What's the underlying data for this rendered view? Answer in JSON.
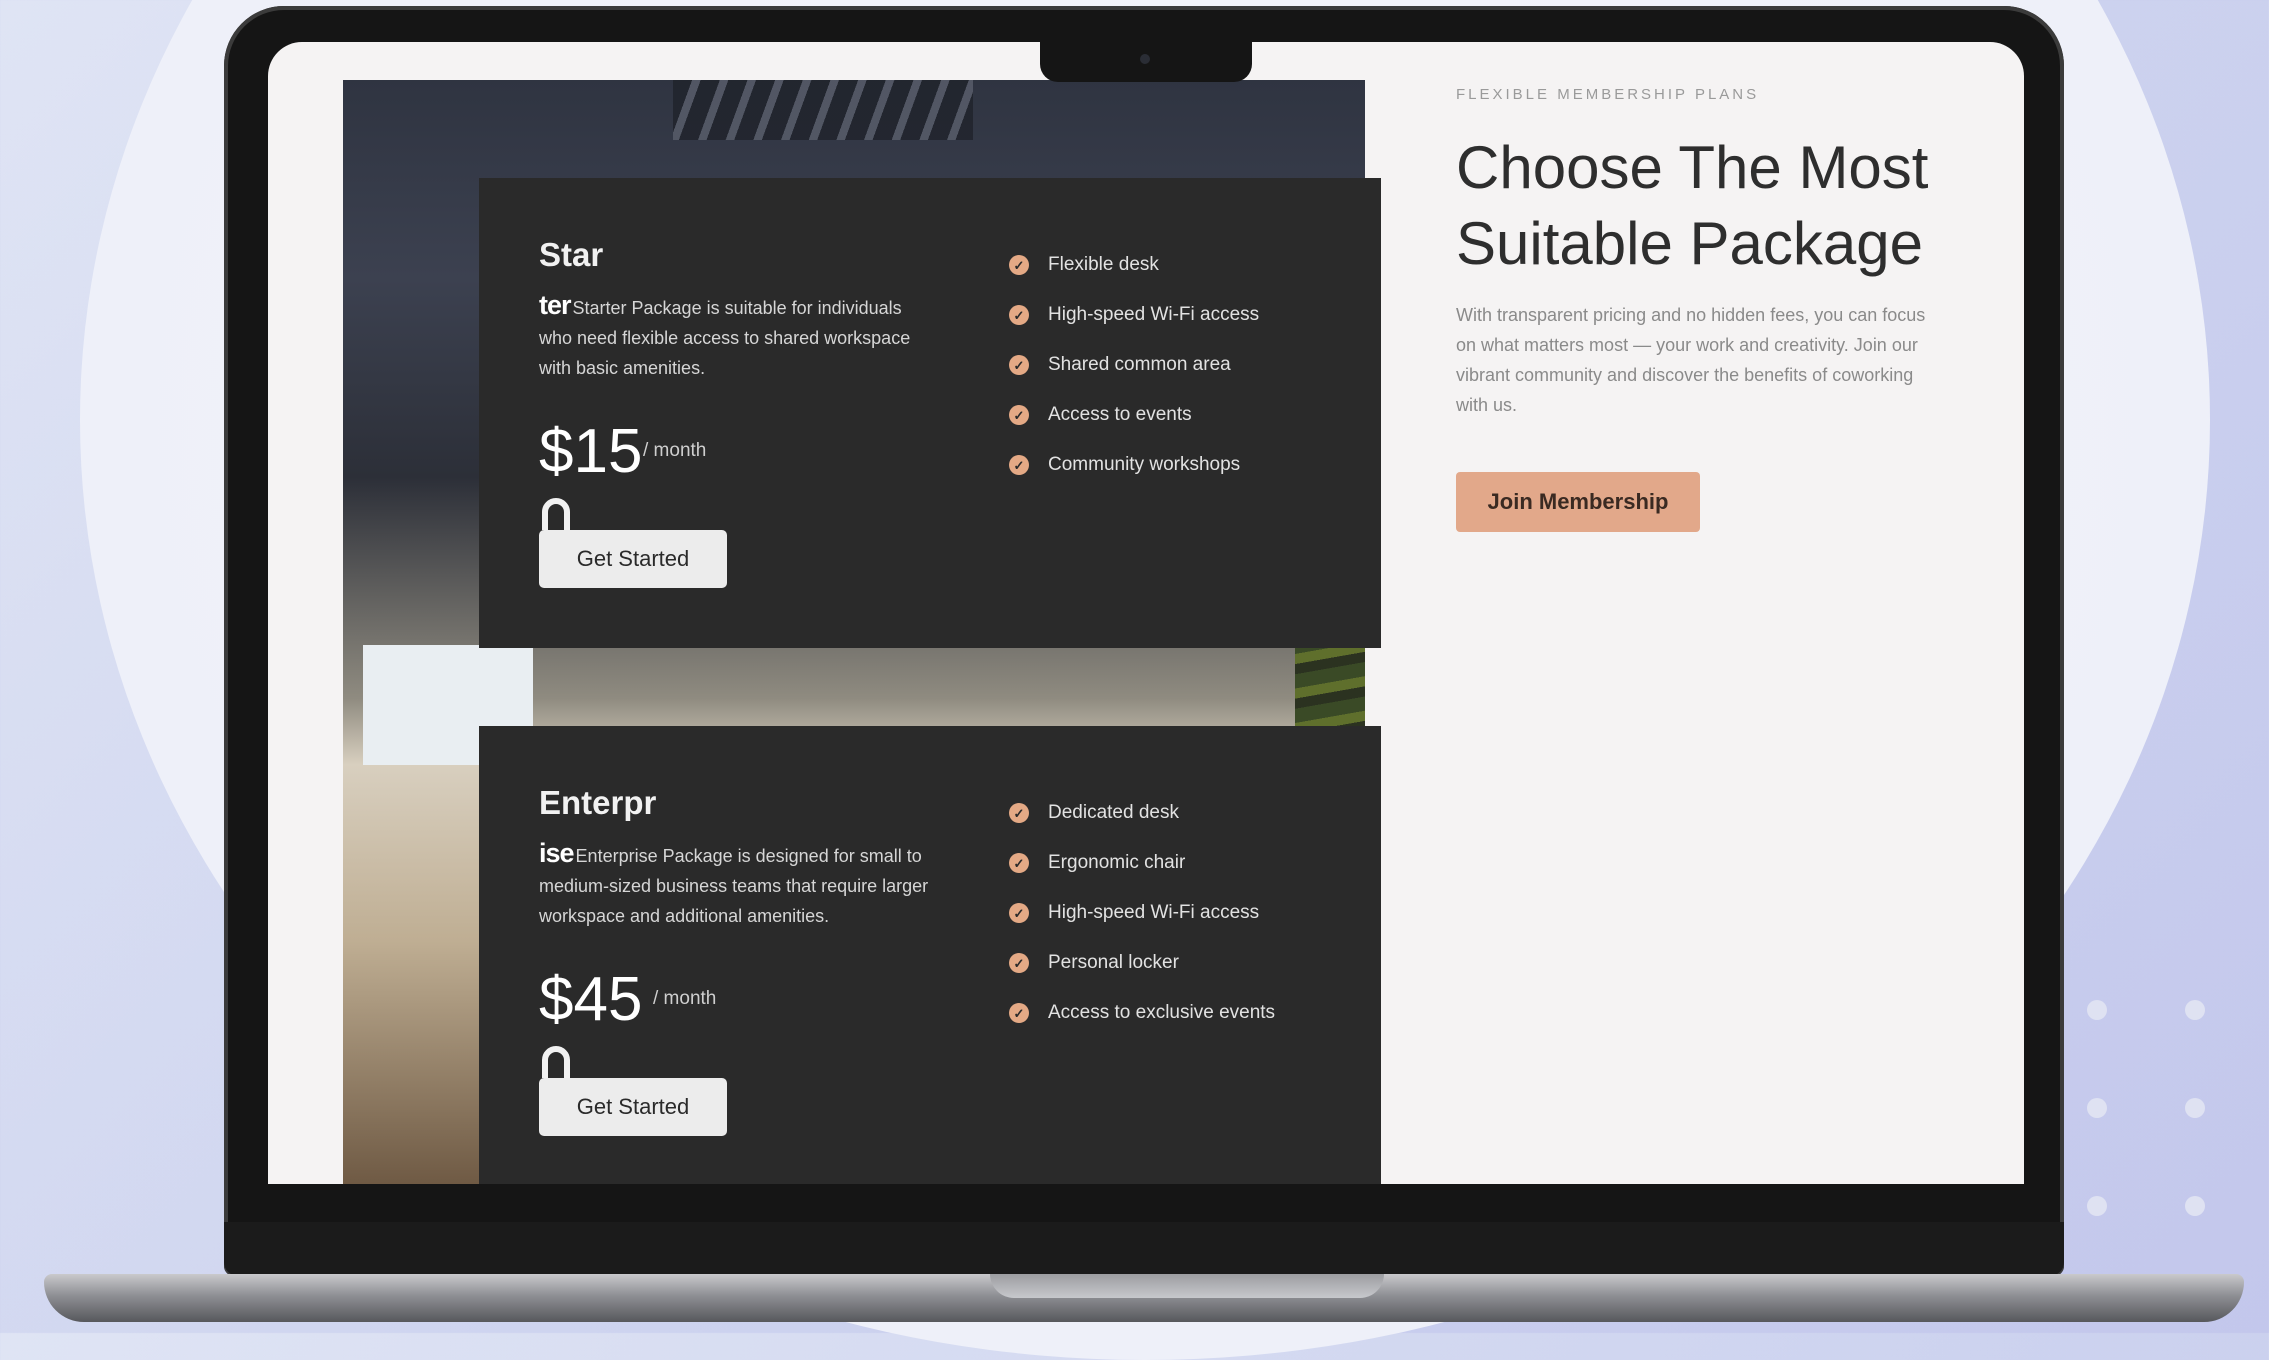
{
  "page": {
    "eyebrow": "FLEXIBLE MEMBERSHIP PLANS",
    "heading": "Choose The Most Suitable Package",
    "lead": "With transparent pricing and no hidden fees, you can focus on what matters most — your work and creativity. Join our vibrant community and discover the benefits of coworking with us.",
    "join_label": "Join Membership"
  },
  "plans": [
    {
      "title": "Star",
      "desc_fragment": "ter",
      "description": "Starter Package is suitable for individuals who need flexible access to shared workspace with basic amenities.",
      "price": "$15",
      "period": "/ month",
      "button": "Get Started",
      "features": [
        "Flexible desk",
        "High-speed Wi-Fi access",
        "Shared common area",
        "Access to events",
        "Community workshops"
      ]
    },
    {
      "title": "Enterpr",
      "desc_fragment": "ise",
      "description": "Enterprise Package is designed for small to medium-sized business teams that require larger workspace and additional amenities.",
      "price": "$45",
      "period": "/ month",
      "button": "Get Started",
      "features": [
        "Dedicated desk",
        "Ergonomic chair",
        "High-speed Wi-Fi access",
        "Personal locker",
        "Access to exclusive events"
      ]
    }
  ],
  "icons": {
    "check": "check-circle-icon",
    "lock": "lock-icon"
  },
  "colors": {
    "accent": "#e2a88a",
    "card_bg": "#2a2a2a",
    "screen_bg": "#f5f3f3"
  }
}
